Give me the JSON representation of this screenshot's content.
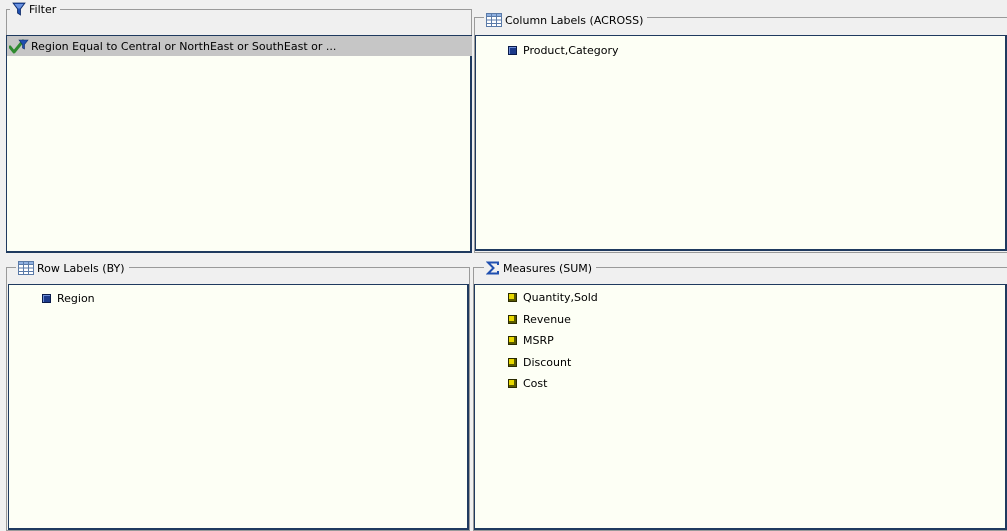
{
  "filter": {
    "title": "Filter",
    "icon": "filter-funnel-icon",
    "condition": "Region Equal to Central or NorthEast or SouthEast or ..."
  },
  "columns": {
    "title": "Column Labels (ACROSS)",
    "icon": "grid-table-icon",
    "items": [
      "Product,Category"
    ]
  },
  "rows": {
    "title": "Row Labels (BY)",
    "icon": "grid-table-icon",
    "items": [
      "Region"
    ]
  },
  "measures": {
    "title": "Measures (SUM)",
    "icon": "sigma-icon",
    "items": [
      "Quantity,Sold",
      "Revenue",
      "MSRP",
      "Discount",
      "Cost"
    ]
  },
  "colors": {
    "dimension_marker": "#1c3a8a",
    "measure_marker": "#e8d800",
    "box_border": "#1f3a5f",
    "box_background": "#fdfff5",
    "selected_row": "#c6c6c6"
  }
}
